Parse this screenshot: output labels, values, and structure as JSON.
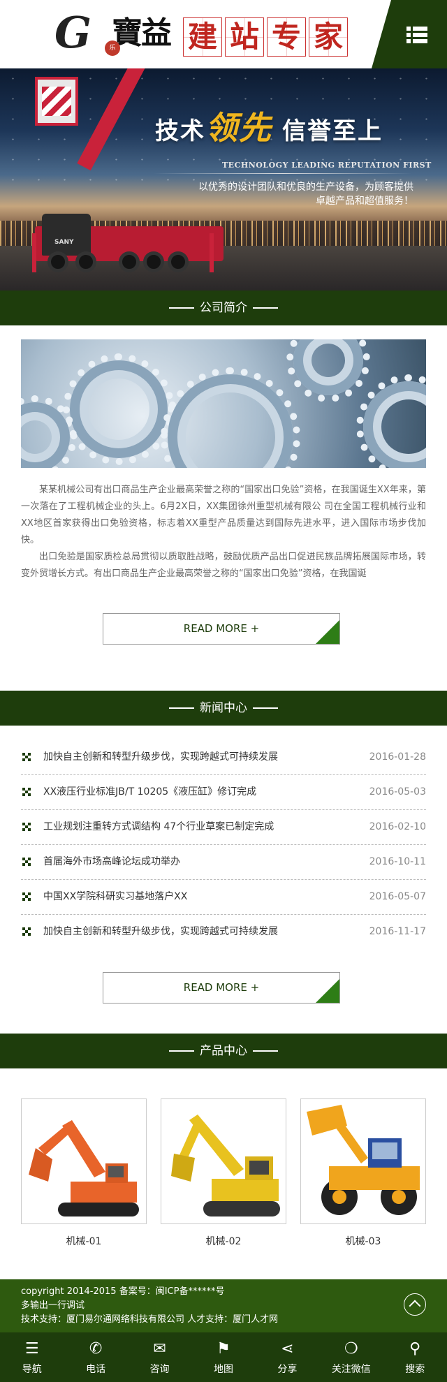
{
  "header": {
    "logo_letter": "G",
    "logo_seal": "乐",
    "brand": "寶益",
    "tagline_chars": [
      "建",
      "站",
      "专",
      "家"
    ],
    "menu_icon": "list-menu-icon"
  },
  "banner": {
    "title_a": "技术",
    "title_hl": "领先",
    "title_b": "信誉至上",
    "subtitle": "TECHNOLOGY LEADING REPUTATION FIRST",
    "desc_line1": "以优秀的设计团队和优良的生产设备，为顾客提供",
    "desc_line2": "卓越产品和超值服务！"
  },
  "about": {
    "heading": "公司简介",
    "para1": "某某机械公司有出口商品生产企业最高荣誉之称的“国家出口免验”资格，在我国诞生XX年来，第一次落在了工程机械企业的头上。6月2X日，XX集团徐州重型机械有限公 司在全国工程机械行业和XX地区首家获得出口免验资格，标志着XX重型产品质量达到国际先进水平，进入国际市场步伐加快。",
    "para2": "出口免验是国家质检总局贯彻以质取胜战略，鼓励优质产品出口促进民族品牌拓展国际市场，转变外贸增长方式。有出口商品生产企业最高荣誉之称的“国家出口免验”资格，在我国诞",
    "more": "READ MORE +"
  },
  "news": {
    "heading": "新闻中心",
    "items": [
      {
        "title": "加快自主创新和转型升级步伐，实现跨越式可持续发展",
        "date": "2016-01-28"
      },
      {
        "title": "XX液压行业标准JB/T 10205《液压缸》修订完成",
        "date": "2016-05-03"
      },
      {
        "title": "工业规划注重转方式调结构 47个行业草案已制定完成",
        "date": "2016-02-10"
      },
      {
        "title": "首届海外市场高峰论坛成功举办",
        "date": "2016-10-11"
      },
      {
        "title": "中国XX学院科研实习基地落户XX",
        "date": "2016-05-07"
      },
      {
        "title": "加快自主创新和转型升级步伐，实现跨越式可持续发展",
        "date": "2016-11-17"
      }
    ],
    "more": "READ MORE +"
  },
  "products": {
    "heading": "产品中心",
    "items": [
      {
        "name": "机械-01",
        "color": "#e8642a"
      },
      {
        "name": "机械-02",
        "color": "#e8c21f"
      },
      {
        "name": "机械-03",
        "color": "#f0a51d"
      }
    ]
  },
  "footer": {
    "line1": "copyright 2014-2015 备案号：闽ICP备******号",
    "line2": "多输出一行调试",
    "line3": "技术支持：厦门易尔通网络科技有限公司 人才支持：厦门人才网"
  },
  "tabbar": [
    {
      "label": "导航",
      "icon": "list-icon",
      "glyph": "☰"
    },
    {
      "label": "电话",
      "icon": "phone-icon",
      "glyph": "✆"
    },
    {
      "label": "咨询",
      "icon": "chat-icon",
      "glyph": "✉"
    },
    {
      "label": "地图",
      "icon": "map-icon",
      "glyph": "⚑"
    },
    {
      "label": "分享",
      "icon": "share-icon",
      "glyph": "⋖"
    },
    {
      "label": "关注微信",
      "icon": "wechat-icon",
      "glyph": "❍"
    },
    {
      "label": "搜索",
      "icon": "search-icon",
      "glyph": "⚲"
    }
  ],
  "colors": {
    "primary": "#1e3d0c",
    "footer": "#2e5a0f",
    "accent": "#2e7d16",
    "seal": "#c0261f"
  }
}
